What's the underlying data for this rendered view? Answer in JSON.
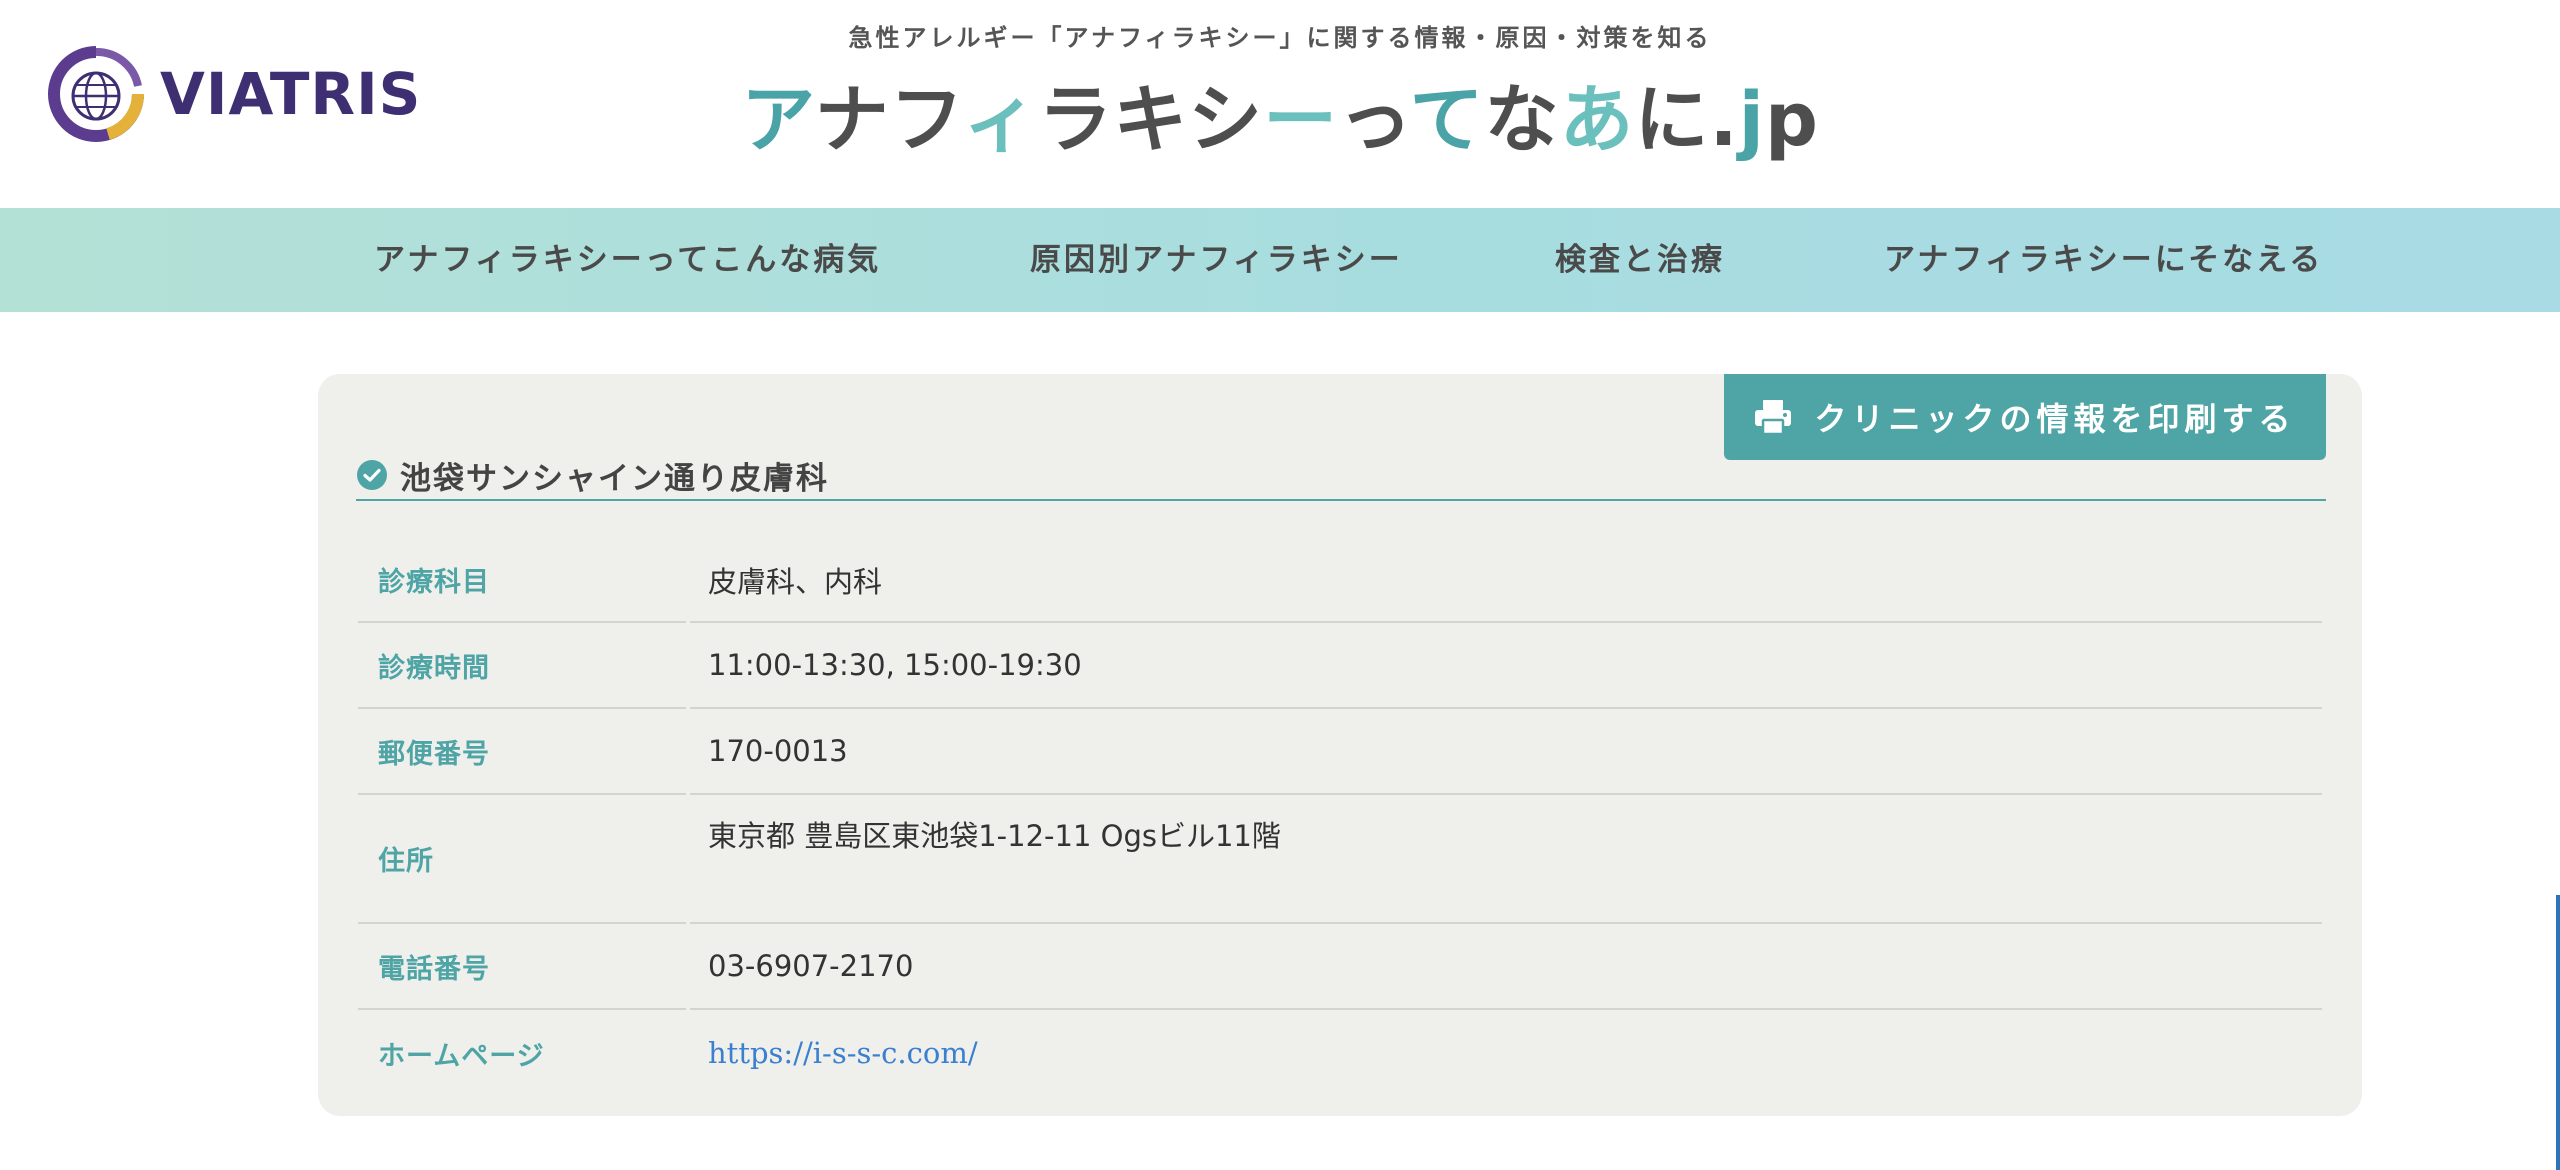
{
  "header": {
    "logo_text": "VIATRIS",
    "tagline": "急性アレルギー「アナフィラキシー」に関する情報・原因・対策を知る",
    "site_title": "アナフィラキシーってなあに.jp"
  },
  "nav": {
    "items": [
      {
        "label": "アナフィラキシーってこんな病気"
      },
      {
        "label": "原因別アナフィラキシー"
      },
      {
        "label": "検査と治療"
      },
      {
        "label": "アナフィラキシーにそなえる"
      }
    ]
  },
  "clinic": {
    "print_label": "クリニックの情報を印刷する",
    "name": "池袋サンシャイン通り皮膚科",
    "rows": [
      {
        "label": "診療科目",
        "value": "皮膚科、内科"
      },
      {
        "label": "診療時間",
        "value": "11:00-13:30, 15:00-19:30"
      },
      {
        "label": "郵便番号",
        "value": "170-0013"
      },
      {
        "label": "住所",
        "value": "東京都 豊島区東池袋1-12-11 Ogsビル11階"
      },
      {
        "label": "電話番号",
        "value": "03-6907-2170"
      },
      {
        "label": "ホームページ",
        "value": "https://i-s-s-c.com/"
      }
    ]
  },
  "colors": {
    "accent": "#4fa5a6",
    "logo_purple": "#3e2f73",
    "link": "#3a7fd0",
    "card_bg": "#efefec"
  },
  "icons": {
    "logo": "viatris-globe-logo",
    "print": "printer-icon",
    "check": "check-circle-icon"
  }
}
